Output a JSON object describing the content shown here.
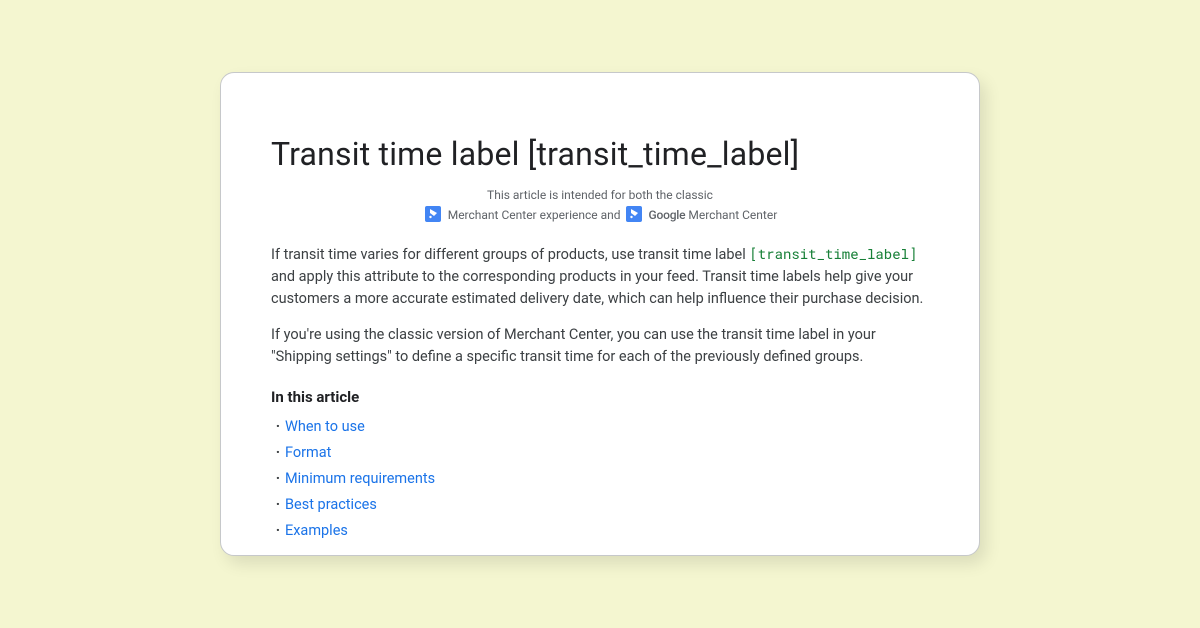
{
  "title": "Transit time label [transit_time_label]",
  "intended": {
    "line1": "This article is intended for both the classic",
    "classic_text": "Merchant Center experience and",
    "google_word": "Google",
    "next_text": " Merchant Center"
  },
  "para1": {
    "a": "If transit time varies for different groups of products, use transit time label ",
    "code": "[transit_time_label]",
    "b": " and apply this attribute to the corresponding products in your feed. Transit time labels help give your customers a more accurate estimated delivery date, which can help influence their purchase decision."
  },
  "para2": "If you're using the classic version of Merchant Center, you can use the transit time label in your \"Shipping settings\" to define a specific transit time for each of the previously defined groups.",
  "toc_heading": "In this article",
  "toc": [
    "When to use",
    "Format",
    "Minimum requirements",
    "Best practices",
    "Examples"
  ]
}
